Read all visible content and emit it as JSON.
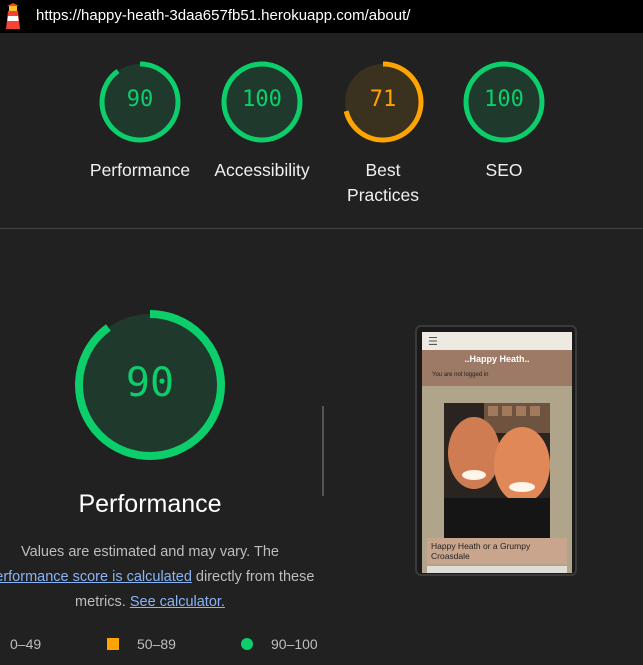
{
  "topbar": {
    "url": "https://happy-heath-3daa657fb51.herokuapp.com/about/"
  },
  "colors": {
    "pass": "#0cce6b",
    "average": "#ffa400",
    "fail": "#ff4e42"
  },
  "scores": [
    {
      "label": "Performance",
      "value": 90
    },
    {
      "label": "Accessibility",
      "value": 100
    },
    {
      "label": "Best Practices",
      "value": 71
    },
    {
      "label": "SEO",
      "value": 100
    }
  ],
  "detail": {
    "score": "90",
    "score_value": 90,
    "title": "Performance",
    "desc_1": "Values are estimated and may vary. The",
    "desc_link_1": "Performance score is calculated",
    "desc_2": " directly from these",
    "desc_3": "metrics. ",
    "desc_link_2": "See calculator."
  },
  "legend": {
    "fail": "0–49",
    "average": "50–89",
    "pass": "90–100"
  },
  "thumbnail": {
    "site_title": "..Happy Heath..",
    "logged_text": "You are not logged in",
    "caption": "Happy Heath or a Grumpy Croasdale"
  }
}
